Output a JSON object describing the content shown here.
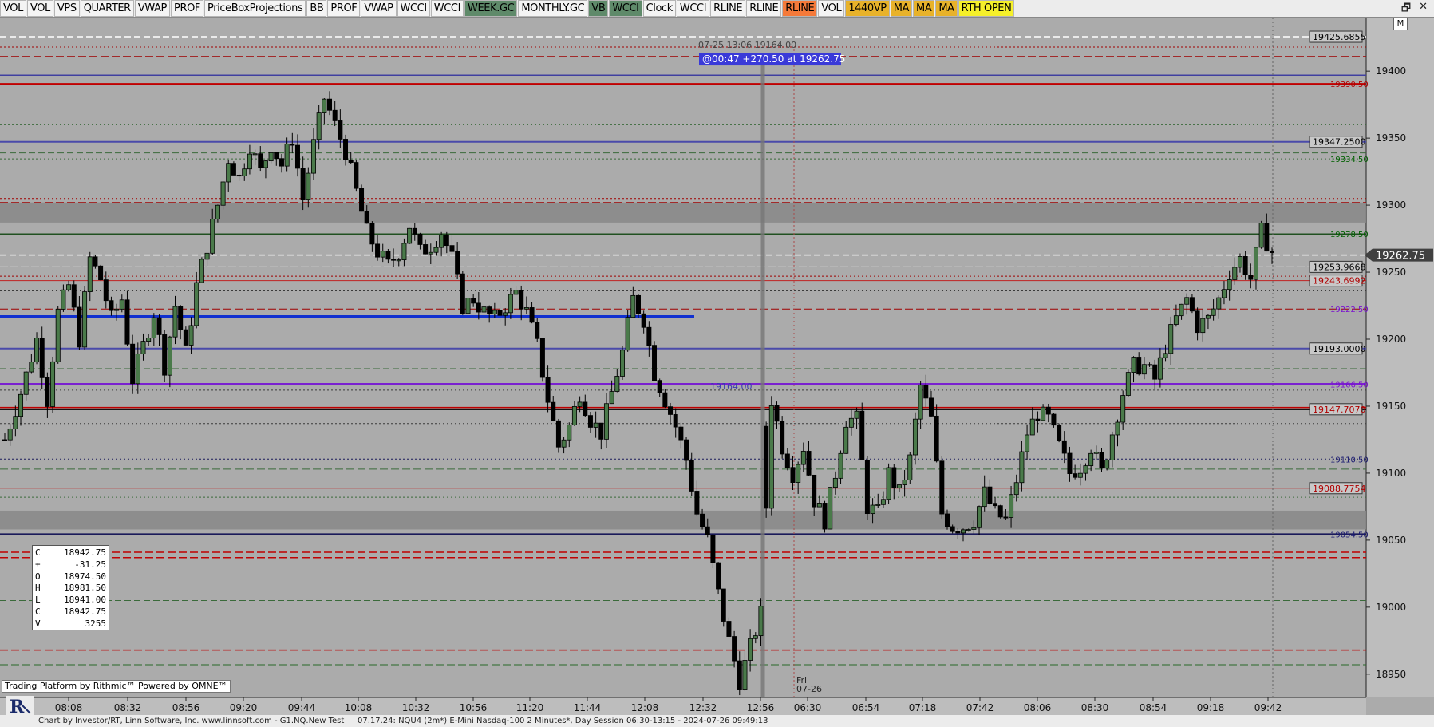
{
  "toolbar": {
    "buttons": [
      {
        "label": "VOL",
        "bg": "#f4f4f4",
        "fg": "#000"
      },
      {
        "label": "VOL",
        "bg": "#f4f4f4",
        "fg": "#000"
      },
      {
        "label": "VPS",
        "bg": "#f4f4f4",
        "fg": "#000"
      },
      {
        "label": "QUARTER",
        "bg": "#f4f4f4",
        "fg": "#000"
      },
      {
        "label": "VWAP",
        "bg": "#f4f4f4",
        "fg": "#000"
      },
      {
        "label": "PROF",
        "bg": "#f4f4f4",
        "fg": "#000"
      },
      {
        "label": "PriceBoxProjections",
        "bg": "#f4f4f4",
        "fg": "#000"
      },
      {
        "label": "BB",
        "bg": "#f4f4f4",
        "fg": "#000"
      },
      {
        "label": "PROF",
        "bg": "#f4f4f4",
        "fg": "#000"
      },
      {
        "label": "VWAP",
        "bg": "#f4f4f4",
        "fg": "#000"
      },
      {
        "label": "WCCI",
        "bg": "#f4f4f4",
        "fg": "#000"
      },
      {
        "label": "WCCI",
        "bg": "#f4f4f4",
        "fg": "#000"
      },
      {
        "label": "WEEK.GC",
        "bg": "#5f8a6a",
        "fg": "#000"
      },
      {
        "label": "MONTHLY.GC",
        "bg": "#f4f4f4",
        "fg": "#000"
      },
      {
        "label": "VB",
        "bg": "#5f8a6a",
        "fg": "#000"
      },
      {
        "label": "WCCI",
        "bg": "#5f8a6a",
        "fg": "#000"
      },
      {
        "label": "Clock",
        "bg": "#f4f4f4",
        "fg": "#000"
      },
      {
        "label": "WCCI",
        "bg": "#f4f4f4",
        "fg": "#000"
      },
      {
        "label": "RLINE",
        "bg": "#f4f4f4",
        "fg": "#000"
      },
      {
        "label": "RLINE",
        "bg": "#f4f4f4",
        "fg": "#000"
      },
      {
        "label": "RLINE",
        "bg": "#f57a3a",
        "fg": "#000"
      },
      {
        "label": "VOL",
        "bg": "#f4f4f4",
        "fg": "#000"
      },
      {
        "label": "1440VP",
        "bg": "#e8b22a",
        "fg": "#000"
      },
      {
        "label": "MA",
        "bg": "#e8b22a",
        "fg": "#000"
      },
      {
        "label": "MA",
        "bg": "#e8b22a",
        "fg": "#000"
      },
      {
        "label": "MA",
        "bg": "#e8b22a",
        "fg": "#000"
      },
      {
        "label": "RTH OPEN",
        "bg": "#f5f02a",
        "fg": "#000"
      }
    ],
    "window_icons": [
      "restore-icon",
      "close-icon"
    ],
    "window_icon_glyphs": [
      "🗗",
      "✕"
    ],
    "m_button": "M"
  },
  "chart_data": {
    "type": "candlestick",
    "instrument": "NQU4 (2m*) E-Mini Nasdaq-100 2 Minutes*",
    "y_ticks": [
      19400,
      19350,
      19300,
      19250,
      19200,
      19150,
      19100,
      19050,
      19000,
      18950
    ],
    "ylim": [
      18935,
      19440
    ],
    "x_ticks": [
      "08:08",
      "08:32",
      "08:56",
      "09:20",
      "09:44",
      "10:08",
      "10:32",
      "10:56",
      "11:20",
      "11:44",
      "12:08",
      "12:32",
      "12:56",
      "06:30",
      "06:54",
      "07:18",
      "07:42",
      "08:06",
      "08:30",
      "08:54",
      "09:18",
      "09:42"
    ],
    "session_divider_label": [
      "Fri",
      "07-26"
    ],
    "last_price": "19262.75",
    "level_labels": [
      {
        "text": "19425.6855",
        "price": 19425.69,
        "color": "#000",
        "boxed": true
      },
      {
        "text": "19390.50",
        "price": 19390.5,
        "color": "#b00000",
        "boxed": false
      },
      {
        "text": "19347.2500",
        "price": 19347.25,
        "color": "#000",
        "boxed": true
      },
      {
        "text": "19334.50",
        "price": 19334.5,
        "color": "#006000",
        "boxed": false
      },
      {
        "text": "19278.50",
        "price": 19278.5,
        "color": "#006000",
        "boxed": false
      },
      {
        "text": "19253.9668",
        "price": 19253.97,
        "color": "#000",
        "boxed": true
      },
      {
        "text": "19243.6992",
        "price": 19243.7,
        "color": "#b00000",
        "boxed": true
      },
      {
        "text": "19222.50",
        "price": 19222.5,
        "color": "#7a10d0",
        "boxed": false
      },
      {
        "text": "19193.0000",
        "price": 19193.0,
        "color": "#000",
        "boxed": true
      },
      {
        "text": "19166.50",
        "price": 19166.5,
        "color": "#7a10d0",
        "boxed": false
      },
      {
        "text": "19147.7070",
        "price": 19147.71,
        "color": "#b00000",
        "boxed": true
      },
      {
        "text": "19110.50",
        "price": 19110.5,
        "color": "#1a1a70",
        "boxed": false
      },
      {
        "text": "19088.7754",
        "price": 19088.78,
        "color": "#b00000",
        "boxed": true
      },
      {
        "text": "19054.50",
        "price": 19054.5,
        "color": "#1a1a70",
        "boxed": false
      }
    ],
    "annotations": [
      {
        "text": "07-25 13:06  19164.00",
        "price": 19425.7,
        "color": "#444"
      },
      {
        "text": "@00:47  +270.50 at 19262.75",
        "price": 19409,
        "color": "#fff",
        "bg": "#3a3ad8"
      },
      {
        "text": "19164.00",
        "price": 19165,
        "color": "#3a3ab0"
      }
    ],
    "close_path": [
      [
        0,
        19125
      ],
      [
        3,
        19160
      ],
      [
        6,
        19200
      ],
      [
        8,
        19155
      ],
      [
        10,
        19220
      ],
      [
        12,
        19240
      ],
      [
        14,
        19200
      ],
      [
        16,
        19260
      ],
      [
        18,
        19245
      ],
      [
        20,
        19215
      ],
      [
        22,
        19230
      ],
      [
        24,
        19170
      ],
      [
        26,
        19195
      ],
      [
        28,
        19220
      ],
      [
        30,
        19180
      ],
      [
        32,
        19225
      ],
      [
        34,
        19190
      ],
      [
        36,
        19240
      ],
      [
        38,
        19270
      ],
      [
        40,
        19300
      ],
      [
        42,
        19335
      ],
      [
        44,
        19320
      ],
      [
        46,
        19345
      ],
      [
        48,
        19325
      ],
      [
        50,
        19345
      ],
      [
        52,
        19330
      ],
      [
        54,
        19350
      ],
      [
        56,
        19305
      ],
      [
        58,
        19345
      ],
      [
        60,
        19380
      ],
      [
        62,
        19360
      ],
      [
        64,
        19340
      ],
      [
        66,
        19310
      ],
      [
        68,
        19280
      ],
      [
        70,
        19265
      ],
      [
        72,
        19255
      ],
      [
        74,
        19265
      ],
      [
        76,
        19285
      ],
      [
        78,
        19265
      ],
      [
        80,
        19270
      ],
      [
        82,
        19280
      ],
      [
        84,
        19260
      ],
      [
        86,
        19225
      ],
      [
        88,
        19230
      ],
      [
        90,
        19220
      ],
      [
        92,
        19215
      ],
      [
        94,
        19225
      ],
      [
        96,
        19235
      ],
      [
        98,
        19220
      ],
      [
        100,
        19195
      ],
      [
        102,
        19155
      ],
      [
        104,
        19120
      ],
      [
        106,
        19135
      ],
      [
        108,
        19160
      ],
      [
        110,
        19140
      ],
      [
        112,
        19130
      ],
      [
        114,
        19160
      ],
      [
        116,
        19190
      ],
      [
        118,
        19230
      ],
      [
        120,
        19215
      ],
      [
        122,
        19175
      ],
      [
        124,
        19155
      ],
      [
        126,
        19135
      ],
      [
        128,
        19110
      ],
      [
        130,
        19070
      ],
      [
        132,
        19050
      ],
      [
        134,
        19010
      ],
      [
        136,
        18975
      ],
      [
        138,
        18945
      ],
      [
        140,
        18970
      ],
      [
        142,
        18995
      ],
      [
        144,
        19155
      ],
      [
        146,
        19120
      ],
      [
        148,
        19100
      ],
      [
        150,
        19120
      ],
      [
        152,
        19080
      ],
      [
        154,
        19065
      ],
      [
        156,
        19100
      ],
      [
        158,
        19140
      ],
      [
        160,
        19140
      ],
      [
        162,
        19075
      ],
      [
        164,
        19070
      ],
      [
        166,
        19100
      ],
      [
        168,
        19085
      ],
      [
        170,
        19110
      ],
      [
        172,
        19165
      ],
      [
        174,
        19140
      ],
      [
        176,
        19070
      ],
      [
        178,
        19060
      ],
      [
        180,
        19060
      ],
      [
        182,
        19065
      ],
      [
        184,
        19085
      ],
      [
        186,
        19070
      ],
      [
        188,
        19065
      ],
      [
        190,
        19095
      ],
      [
        192,
        19130
      ],
      [
        194,
        19145
      ],
      [
        196,
        19140
      ],
      [
        198,
        19120
      ],
      [
        200,
        19100
      ],
      [
        202,
        19105
      ],
      [
        204,
        19120
      ],
      [
        206,
        19100
      ],
      [
        208,
        19130
      ],
      [
        210,
        19160
      ],
      [
        212,
        19180
      ],
      [
        214,
        19180
      ],
      [
        216,
        19170
      ],
      [
        218,
        19195
      ],
      [
        220,
        19215
      ],
      [
        222,
        19230
      ],
      [
        224,
        19210
      ],
      [
        226,
        19215
      ],
      [
        228,
        19230
      ],
      [
        230,
        19250
      ],
      [
        232,
        19260
      ],
      [
        234,
        19245
      ],
      [
        236,
        19280
      ],
      [
        238,
        19265
      ]
    ],
    "ohlc_box": [
      [
        "C",
        "18942.75"
      ],
      [
        "±",
        "-31.25"
      ],
      [
        "O",
        "18974.50"
      ],
      [
        "H",
        "18981.50"
      ],
      [
        "L",
        "18941.00"
      ],
      [
        "C",
        "18942.75"
      ],
      [
        "V",
        "3255"
      ]
    ]
  },
  "footer": {
    "left": "Chart by Investor/RT, Linn Software, Inc. www.linnsoft.com - G1.NQ.New Test",
    "right": "07.17.24: NQU4 (2m*) E-Mini Nasdaq-100 2 Minutes*, Day Session 06:30-13:15 - 2024-07-26 09:49:13"
  },
  "badges": {
    "rithmic": "Trading Platform by Rithmic™   Powered by OMNE™"
  }
}
